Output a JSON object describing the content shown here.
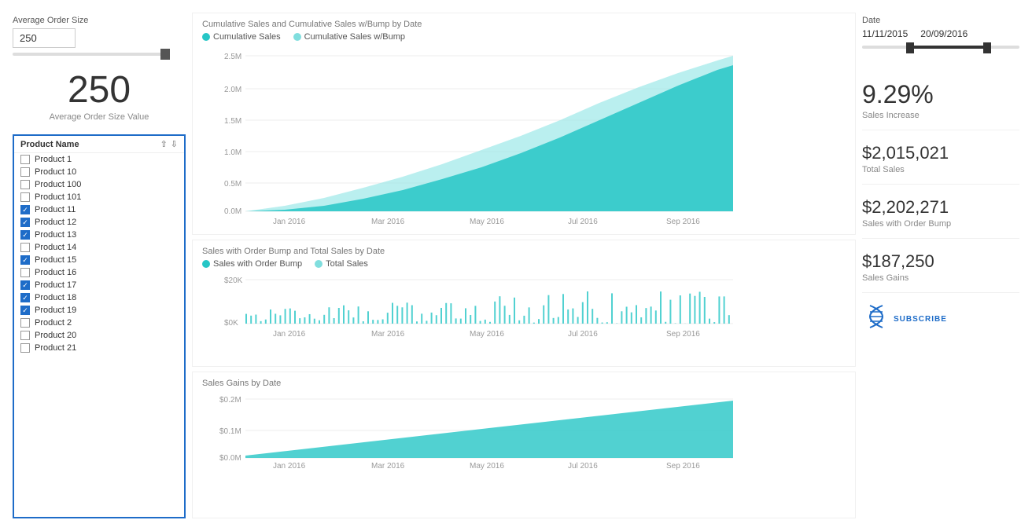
{
  "left": {
    "avg_order_label": "Average Order Size",
    "avg_order_value": "250",
    "big_number": "250",
    "big_number_label": "Average Order Size Value",
    "product_list_title": "Product Name",
    "products": [
      {
        "name": "Product 1",
        "checked": false
      },
      {
        "name": "Product 10",
        "checked": false
      },
      {
        "name": "Product 100",
        "checked": false
      },
      {
        "name": "Product 101",
        "checked": false
      },
      {
        "name": "Product 11",
        "checked": true
      },
      {
        "name": "Product 12",
        "checked": true
      },
      {
        "name": "Product 13",
        "checked": true
      },
      {
        "name": "Product 14",
        "checked": false
      },
      {
        "name": "Product 15",
        "checked": true
      },
      {
        "name": "Product 16",
        "checked": false
      },
      {
        "name": "Product 17",
        "checked": true
      },
      {
        "name": "Product 18",
        "checked": true
      },
      {
        "name": "Product 19",
        "checked": true
      },
      {
        "name": "Product 2",
        "checked": false
      },
      {
        "name": "Product 20",
        "checked": false
      },
      {
        "name": "Product 21",
        "checked": false
      }
    ]
  },
  "charts": {
    "cumulative": {
      "title": "Cumulative Sales and Cumulative Sales w/Bump by Date",
      "legend1": "Cumulative Sales",
      "legend2": "Cumulative Sales w/Bump",
      "legend1_color": "#26c6c6",
      "legend2_color": "#80dede",
      "y_labels": [
        "2.5M",
        "2.0M",
        "1.5M",
        "1.0M",
        "0.5M",
        "0.0M"
      ],
      "x_labels": [
        "Jan 2016",
        "Mar 2016",
        "May 2016",
        "Jul 2016",
        "Sep 2016"
      ]
    },
    "sales_bump": {
      "title": "Sales with Order Bump and Total Sales by Date",
      "legend1": "Sales with Order Bump",
      "legend2": "Total Sales",
      "legend1_color": "#26c6c6",
      "legend2_color": "#80dede",
      "y_labels": [
        "$20K",
        "$0K"
      ],
      "x_labels": [
        "Jan 2016",
        "Mar 2016",
        "May 2016",
        "Jul 2016",
        "Sep 2016"
      ]
    },
    "gains": {
      "title": "Sales Gains by Date",
      "y_labels": [
        "$0.2M",
        "$0.1M",
        "$0.0M"
      ],
      "x_labels": [
        "Jan 2016",
        "Mar 2016",
        "May 2016",
        "Jul 2016",
        "Sep 2016"
      ]
    }
  },
  "right": {
    "date_label": "Date",
    "date_from": "11/11/2015",
    "date_to": "20/09/2016",
    "kpis": [
      {
        "value": "9.29%",
        "label": "Sales Increase"
      },
      {
        "value": "$2,015,021",
        "label": "Total Sales"
      },
      {
        "value": "$2,202,271",
        "label": "Sales with Order Bump"
      },
      {
        "value": "$187,250",
        "label": "Sales Gains"
      }
    ],
    "subscribe_text": "SUBSCRIBE"
  }
}
